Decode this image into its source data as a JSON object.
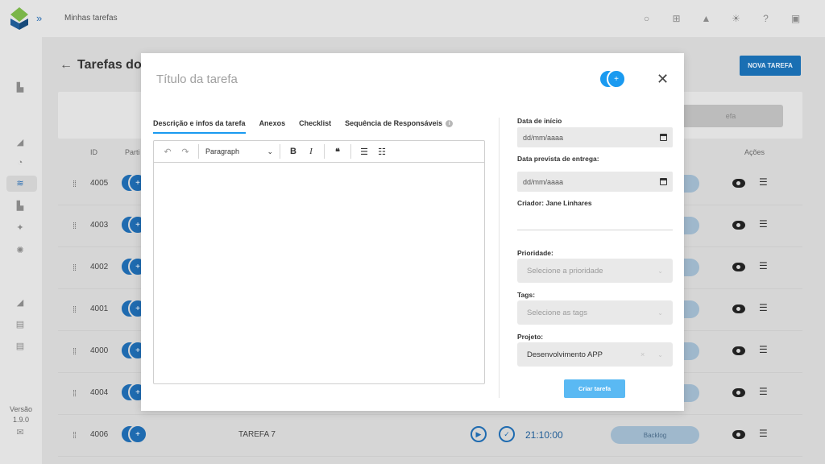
{
  "topbar": {
    "breadcrumb": "Minhas tarefas",
    "icons": [
      "search-icon",
      "plus-box-icon",
      "bell-icon",
      "sun-icon",
      "help-icon",
      "image-icon"
    ]
  },
  "sidebar": {
    "version_label": "Versão",
    "version_number": "1.9.0"
  },
  "page": {
    "title": "Tarefas do p",
    "new_task_button": "NOVA TAREFA",
    "filter_button": "efa",
    "columns": {
      "id": "ID",
      "participants": "Parti",
      "actions": "Ações"
    }
  },
  "rows": [
    {
      "id": "4005"
    },
    {
      "id": "4003"
    },
    {
      "id": "4002"
    },
    {
      "id": "4001"
    },
    {
      "id": "4000"
    },
    {
      "id": "4004"
    },
    {
      "id": "4006",
      "name": "TAREFA 7",
      "time": "21:10:00",
      "status": "Backlog"
    }
  ],
  "modal": {
    "title_placeholder": "Título da tarefa",
    "tabs": [
      {
        "label": "Descrição e infos da tarefa",
        "active": true
      },
      {
        "label": "Anexos"
      },
      {
        "label": "Checklist"
      },
      {
        "label": "Sequência de Responsáveis"
      }
    ],
    "editor": {
      "paragraph_select": "Paragraph"
    },
    "start_date_label": "Data de início",
    "start_date_placeholder": "dd/mm/aaaa",
    "due_date_label": "Data prevista de entrega:",
    "due_date_placeholder": "dd/mm/aaaa",
    "creator": "Criador: Jane Linhares",
    "priority_label": "Prioridade:",
    "priority_placeholder": "Selecione a prioridade",
    "tags_label": "Tags:",
    "tags_placeholder": "Selecione as tags",
    "project_label": "Projeto:",
    "project_value": "Desenvolvimento APP",
    "submit_button": "Criar tarefa"
  },
  "colors": {
    "accent": "#1a9af0",
    "submit": "#5ab9f3",
    "brand": "#1a6fb3"
  }
}
